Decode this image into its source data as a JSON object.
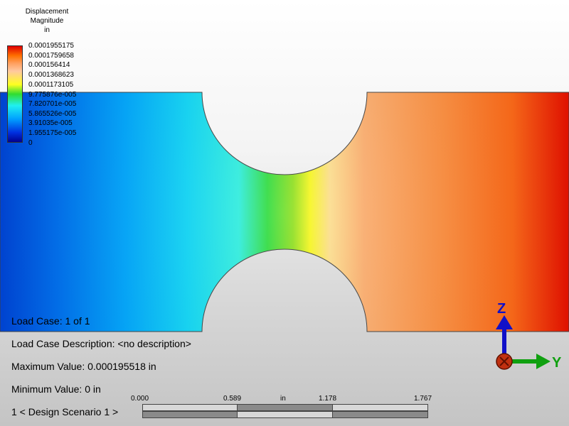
{
  "legend": {
    "title_line1": "Displacement",
    "title_line2": "Magnitude",
    "units": "in",
    "labels": [
      "0.0001955175",
      "0.0001759658",
      "0.000156414",
      "0.0001368623",
      "0.0001173105",
      "9.775876e-005",
      "7.820701e-005",
      "5.865526e-005",
      "3.91035e-005",
      "1.955175e-005",
      "0"
    ]
  },
  "info": {
    "load_case": "Load Case:  1 of 1",
    "load_case_description": "Load Case Description:  <no description>",
    "max_value": "Maximum Value: 0.000195518 in",
    "min_value": "Minimum Value: 0 in",
    "design_scenario": "1 < Design Scenario 1 >"
  },
  "scale": {
    "ticks": [
      "0.000",
      "0.589",
      "in",
      "1.178",
      "1.767"
    ]
  },
  "triad": {
    "z_label": "Z",
    "y_label": "Y"
  },
  "colors": {
    "min": "#0030c0",
    "max": "#e00000"
  }
}
